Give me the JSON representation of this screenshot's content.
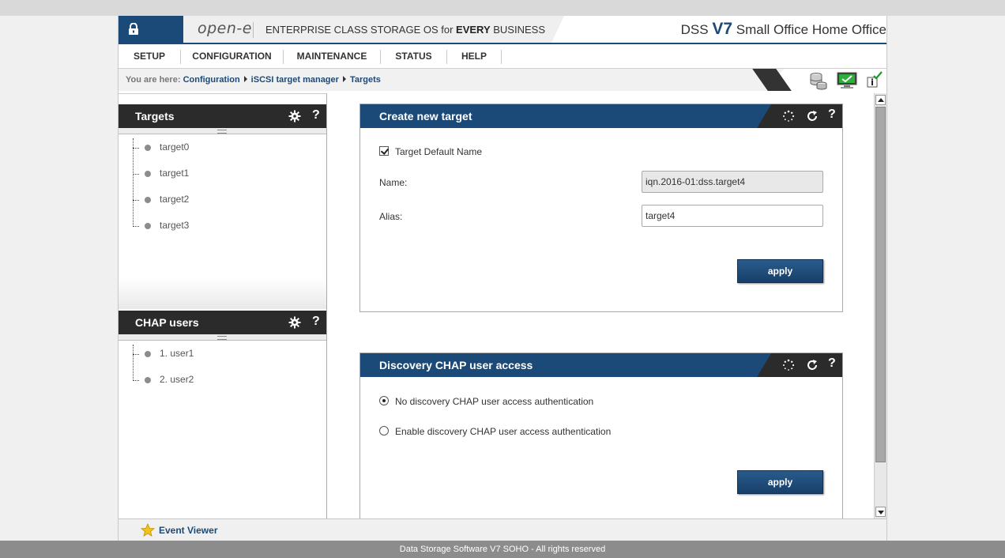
{
  "header": {
    "logo": "open-e",
    "tagline_pre": "ENTERPRISE CLASS STORAGE OS for ",
    "tagline_bold": "EVERY",
    "tagline_post": " BUSINESS",
    "product_pre": "DSS",
    "product_version": "V7",
    "product_edition": "Small Office Home Office"
  },
  "nav": {
    "items": [
      {
        "label": "SETUP"
      },
      {
        "label": "CONFIGURATION"
      },
      {
        "label": "MAINTENANCE"
      },
      {
        "label": "STATUS"
      },
      {
        "label": "HELP"
      }
    ]
  },
  "breadcrumb": {
    "prefix": "You are here:",
    "items": [
      "Configuration",
      "iSCSI target manager",
      "Targets"
    ]
  },
  "targets_panel": {
    "title": "Targets",
    "help": "?",
    "items": [
      "target0",
      "target1",
      "target2",
      "target3"
    ]
  },
  "chap_panel": {
    "title": "CHAP users",
    "help": "?",
    "items": [
      "1. user1",
      "2. user2"
    ]
  },
  "create_target": {
    "title": "Create new target",
    "help": "?",
    "default_name_label": "Target Default Name",
    "default_name_checked": true,
    "name_label": "Name:",
    "name_value": "iqn.2016-01:dss.target4",
    "alias_label": "Alias:",
    "alias_value": "target4",
    "apply": "apply"
  },
  "discovery_chap": {
    "title": "Discovery CHAP user access",
    "help": "?",
    "option_none": "No discovery CHAP user access authentication",
    "option_enable": "Enable discovery CHAP user access authentication",
    "selected": "none",
    "apply": "apply"
  },
  "event_viewer": {
    "label": "Event Viewer"
  },
  "footer": {
    "text": "Data Storage Software V7 SOHO - All rights reserved"
  },
  "colors": {
    "brand_blue": "#1c4a78",
    "dark": "#2b2b2b",
    "accent_red": "#dd3333"
  }
}
